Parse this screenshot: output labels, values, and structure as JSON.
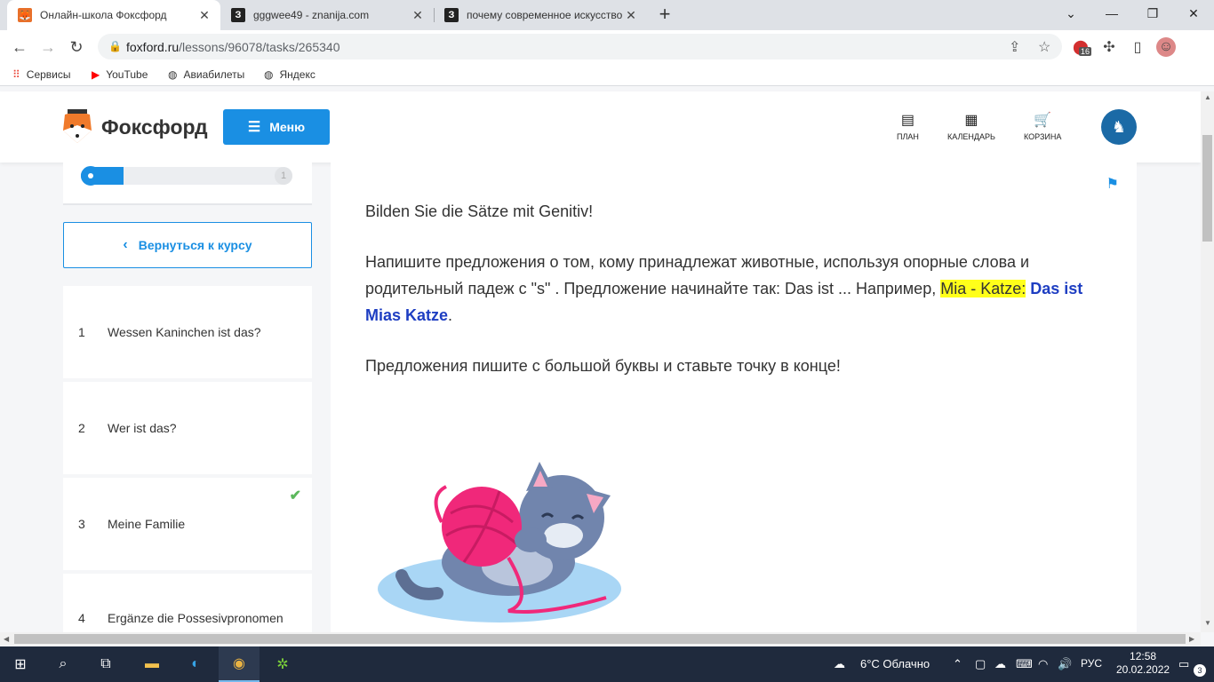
{
  "browser": {
    "tabs": [
      {
        "title": "Онлайн-школа Фоксфорд",
        "favicon": "fox-icon",
        "active": true
      },
      {
        "title": "gggwee49 - znanija.com",
        "favicon": "znanija-icon",
        "active": false
      },
      {
        "title": "почему современное искусство",
        "favicon": "znanija-icon",
        "active": false
      }
    ],
    "url_host": "foxford.ru",
    "url_path": "/lessons/96078/tasks/265340",
    "extension_badge": "16",
    "bookmarks": [
      {
        "label": "Сервисы",
        "icon": "apps-grid-icon"
      },
      {
        "label": "YouTube",
        "icon": "youtube-icon"
      },
      {
        "label": "Авиабилеты",
        "icon": "globe-icon"
      },
      {
        "label": "Яндекс",
        "icon": "globe-icon"
      }
    ]
  },
  "site": {
    "logo_text": "Фоксфорд",
    "menu_label": "Меню",
    "nav": [
      {
        "label": "ПЛАН",
        "icon": "plan-icon"
      },
      {
        "label": "КАЛЕНДАРЬ",
        "icon": "calendar-icon"
      },
      {
        "label": "КОРЗИНА",
        "icon": "cart-icon"
      }
    ]
  },
  "sidebar": {
    "progress": {
      "value_fraction": 0.2,
      "end_label": "1"
    },
    "back_label": "Вернуться к курсу",
    "lessons": [
      {
        "num": "1",
        "title": "Wessen Kaninchen ist das?",
        "done": false
      },
      {
        "num": "2",
        "title": "Wer ist das?",
        "done": false
      },
      {
        "num": "3",
        "title": "Meine Familie",
        "done": true
      },
      {
        "num": "4",
        "title": "Ergänze die Possesivpronomen",
        "done": false
      }
    ]
  },
  "task": {
    "heading": "Bilden Sie die Sätze mit Genitiv!",
    "instruction_part1": "Напишите предложения о том, кому принадлежат животные, используя опорные слова и родительный падеж с \"s\" . Предложение начинайте так: Das ist ... Например, ",
    "example_highlight": "Mia - Katze:",
    "example_answer": "Das ist Mias Katze",
    "instruction_end": ".",
    "note": "Предложения пишите с большой буквы и ставьте точку в конце!"
  },
  "taskbar": {
    "weather": "6°C  Облачно",
    "lang": "РУС",
    "time": "12:58",
    "date": "20.02.2022",
    "notifications": "3"
  }
}
